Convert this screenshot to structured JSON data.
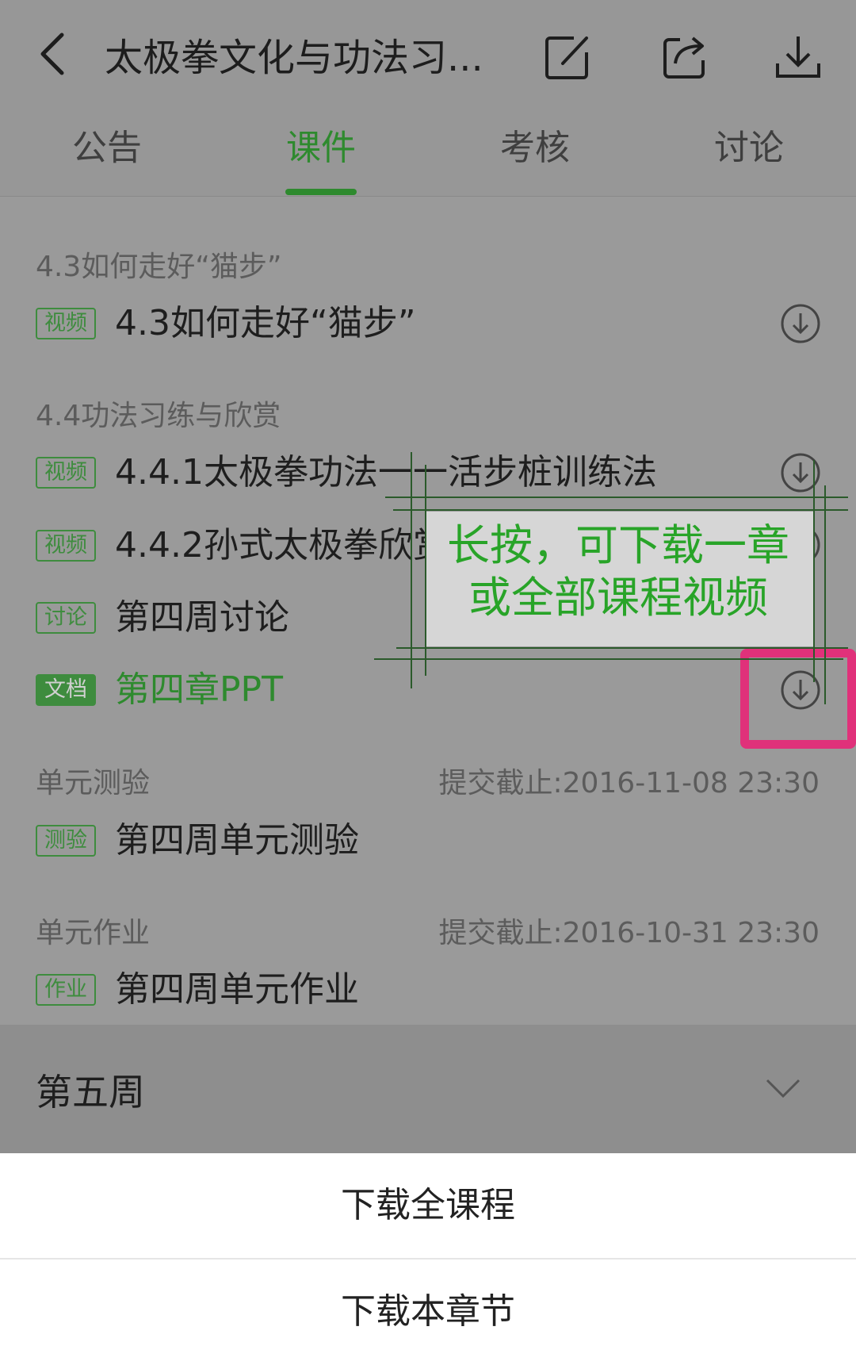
{
  "header": {
    "title": "太极拳文化与功法习...",
    "icons": [
      "back-arrow-icon",
      "edit-icon",
      "share-icon",
      "download-icon"
    ]
  },
  "tabs": [
    {
      "label": "公告",
      "active": false
    },
    {
      "label": "课件",
      "active": true
    },
    {
      "label": "考核",
      "active": false
    },
    {
      "label": "讨论",
      "active": false
    }
  ],
  "sections": [
    {
      "title": "4.3如何走好“猫步”",
      "items": [
        {
          "badge": "视频",
          "text": "4.3如何走好“猫步”"
        }
      ]
    },
    {
      "title": "4.4功法习练与欣赏",
      "items": [
        {
          "badge": "视频",
          "text": "4.4.1太极拳功法一一活步桩训练法"
        },
        {
          "badge": "视频",
          "text": "4.4.2孙式太极拳欣赏"
        },
        {
          "badge": "讨论",
          "text": "第四周讨论"
        },
        {
          "badge": "文档",
          "text": "第四章PPT"
        }
      ]
    },
    {
      "title": "单元测验",
      "deadline": "提交截止:2016-11-08 23:30",
      "items": [
        {
          "badge": "测验",
          "text": "第四周单元测验"
        }
      ]
    },
    {
      "title": "单元作业",
      "deadline": "提交截止:2016-10-31 23:30",
      "items": [
        {
          "badge": "作业",
          "text": "第四周单元作业"
        }
      ]
    }
  ],
  "week": {
    "label": "第五周"
  },
  "sheet": {
    "download_all": "下载全课程",
    "download_chapter": "下载本章节"
  },
  "annotation": {
    "line1": "长按，可下载一章",
    "line2": "或全部课程视频"
  },
  "colors": {
    "accent_green": "#2e8a2e",
    "highlight_pink": "#e0317a",
    "overlay_gray": "#9a9a9a"
  }
}
